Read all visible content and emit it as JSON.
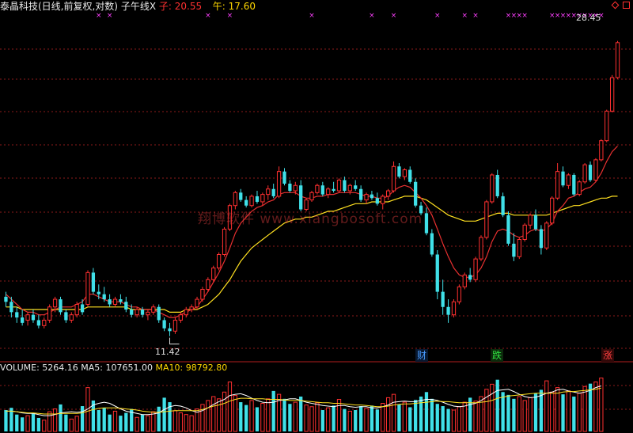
{
  "header": {
    "title": "泰晶科技(日线,前复权,对数)",
    "indicator": "子午线X",
    "zi_label": "子:",
    "zi_value": "20.55",
    "wu_label": "午:",
    "wu_value": "17.60"
  },
  "price_labels": {
    "high": "28.45",
    "low": "11.42"
  },
  "badges": {
    "cai": "财",
    "die": "跌",
    "zhang": "涨"
  },
  "volume_header": {
    "volume_label": "VOLUME:",
    "volume_value": "5264.16",
    "ma5_label": "MA5:",
    "ma5_value": "107651.00",
    "ma10_label": "MA10:",
    "ma10_value": "98792.80"
  },
  "watermark": "翔博软件 www.xiangbosoft.com",
  "colors": {
    "up": "#ff3030",
    "down": "#40e0e8",
    "line_zi": "#e83030",
    "line_wu": "#ffe020",
    "grid": "#8b1a1a",
    "marker": "#ff40ff"
  },
  "chart_data": {
    "type": "candlestick",
    "scale": "log",
    "candles": [
      {
        "o": 12.9,
        "h": 13.1,
        "l": 12.5,
        "c": 12.7
      },
      {
        "o": 12.7,
        "h": 12.9,
        "l": 12.1,
        "c": 12.3
      },
      {
        "o": 12.3,
        "h": 12.5,
        "l": 11.9,
        "c": 12.1
      },
      {
        "o": 12.1,
        "h": 12.4,
        "l": 11.8,
        "c": 11.9
      },
      {
        "o": 12.0,
        "h": 12.3,
        "l": 11.8,
        "c": 12.2
      },
      {
        "o": 12.2,
        "h": 12.4,
        "l": 11.9,
        "c": 12.0
      },
      {
        "o": 12.0,
        "h": 12.2,
        "l": 11.7,
        "c": 11.8
      },
      {
        "o": 11.8,
        "h": 12.1,
        "l": 11.7,
        "c": 12.0
      },
      {
        "o": 12.0,
        "h": 12.6,
        "l": 11.9,
        "c": 12.5
      },
      {
        "o": 12.5,
        "h": 12.9,
        "l": 12.3,
        "c": 12.8
      },
      {
        "o": 12.8,
        "h": 12.9,
        "l": 12.2,
        "c": 12.3
      },
      {
        "o": 12.3,
        "h": 12.4,
        "l": 11.9,
        "c": 12.0
      },
      {
        "o": 12.0,
        "h": 12.3,
        "l": 11.9,
        "c": 12.2
      },
      {
        "o": 12.2,
        "h": 12.7,
        "l": 12.1,
        "c": 12.6
      },
      {
        "o": 12.6,
        "h": 12.8,
        "l": 12.2,
        "c": 12.3
      },
      {
        "o": 12.6,
        "h": 14.0,
        "l": 12.5,
        "c": 13.9
      },
      {
        "o": 13.9,
        "h": 14.1,
        "l": 13.0,
        "c": 13.1
      },
      {
        "o": 13.1,
        "h": 13.4,
        "l": 12.8,
        "c": 13.0
      },
      {
        "o": 13.0,
        "h": 13.3,
        "l": 12.7,
        "c": 12.8
      },
      {
        "o": 12.8,
        "h": 13.0,
        "l": 12.5,
        "c": 12.6
      },
      {
        "o": 12.6,
        "h": 12.9,
        "l": 12.5,
        "c": 12.8
      },
      {
        "o": 12.8,
        "h": 13.0,
        "l": 12.6,
        "c": 12.7
      },
      {
        "o": 12.7,
        "h": 12.9,
        "l": 12.3,
        "c": 12.4
      },
      {
        "o": 12.4,
        "h": 12.6,
        "l": 12.1,
        "c": 12.2
      },
      {
        "o": 12.2,
        "h": 12.5,
        "l": 12.1,
        "c": 12.4
      },
      {
        "o": 12.4,
        "h": 12.5,
        "l": 12.1,
        "c": 12.2
      },
      {
        "o": 12.2,
        "h": 12.4,
        "l": 12.0,
        "c": 12.3
      },
      {
        "o": 12.3,
        "h": 12.6,
        "l": 12.2,
        "c": 12.5
      },
      {
        "o": 12.5,
        "h": 12.6,
        "l": 11.9,
        "c": 12.0
      },
      {
        "o": 12.0,
        "h": 12.1,
        "l": 11.6,
        "c": 11.7
      },
      {
        "o": 11.7,
        "h": 11.9,
        "l": 11.42,
        "c": 11.6
      },
      {
        "o": 11.6,
        "h": 12.1,
        "l": 11.5,
        "c": 12.0
      },
      {
        "o": 12.0,
        "h": 12.3,
        "l": 11.9,
        "c": 12.2
      },
      {
        "o": 12.2,
        "h": 12.5,
        "l": 12.1,
        "c": 12.4
      },
      {
        "o": 12.4,
        "h": 12.6,
        "l": 12.3,
        "c": 12.5
      },
      {
        "o": 12.5,
        "h": 12.9,
        "l": 12.4,
        "c": 12.8
      },
      {
        "o": 12.8,
        "h": 13.3,
        "l": 12.7,
        "c": 13.2
      },
      {
        "o": 13.2,
        "h": 13.7,
        "l": 13.1,
        "c": 13.6
      },
      {
        "o": 13.6,
        "h": 14.2,
        "l": 13.5,
        "c": 14.1
      },
      {
        "o": 14.1,
        "h": 14.8,
        "l": 14.0,
        "c": 14.7
      },
      {
        "o": 14.7,
        "h": 16.0,
        "l": 14.6,
        "c": 15.9
      },
      {
        "o": 15.9,
        "h": 17.2,
        "l": 15.8,
        "c": 17.1
      },
      {
        "o": 17.1,
        "h": 17.9,
        "l": 16.9,
        "c": 17.8
      },
      {
        "o": 17.8,
        "h": 18.0,
        "l": 17.3,
        "c": 17.4
      },
      {
        "o": 17.4,
        "h": 17.6,
        "l": 17.0,
        "c": 17.1
      },
      {
        "o": 17.1,
        "h": 17.7,
        "l": 17.0,
        "c": 17.6
      },
      {
        "o": 17.6,
        "h": 17.9,
        "l": 17.2,
        "c": 17.3
      },
      {
        "o": 17.3,
        "h": 17.8,
        "l": 17.1,
        "c": 17.7
      },
      {
        "o": 17.7,
        "h": 18.2,
        "l": 17.4,
        "c": 18.0
      },
      {
        "o": 18.0,
        "h": 18.3,
        "l": 17.5,
        "c": 17.6
      },
      {
        "o": 17.6,
        "h": 19.3,
        "l": 17.5,
        "c": 19.0
      },
      {
        "o": 19.0,
        "h": 19.2,
        "l": 18.2,
        "c": 18.3
      },
      {
        "o": 18.3,
        "h": 18.5,
        "l": 17.8,
        "c": 17.9
      },
      {
        "o": 17.9,
        "h": 18.4,
        "l": 17.7,
        "c": 18.2
      },
      {
        "o": 18.2,
        "h": 18.5,
        "l": 16.8,
        "c": 16.9
      },
      {
        "o": 16.9,
        "h": 17.5,
        "l": 16.8,
        "c": 17.4
      },
      {
        "o": 17.4,
        "h": 17.9,
        "l": 17.3,
        "c": 17.8
      },
      {
        "o": 17.8,
        "h": 18.3,
        "l": 17.7,
        "c": 18.2
      },
      {
        "o": 18.2,
        "h": 18.4,
        "l": 17.6,
        "c": 17.7
      },
      {
        "o": 17.7,
        "h": 18.1,
        "l": 17.5,
        "c": 18.0
      },
      {
        "o": 18.0,
        "h": 18.4,
        "l": 17.8,
        "c": 17.9
      },
      {
        "o": 17.9,
        "h": 18.6,
        "l": 17.8,
        "c": 18.5
      },
      {
        "o": 18.5,
        "h": 18.7,
        "l": 17.8,
        "c": 17.9
      },
      {
        "o": 17.9,
        "h": 18.3,
        "l": 17.7,
        "c": 18.2
      },
      {
        "o": 18.2,
        "h": 18.5,
        "l": 17.9,
        "c": 18.0
      },
      {
        "o": 18.0,
        "h": 18.2,
        "l": 17.3,
        "c": 17.4
      },
      {
        "o": 17.4,
        "h": 17.8,
        "l": 17.2,
        "c": 17.7
      },
      {
        "o": 17.7,
        "h": 17.9,
        "l": 17.4,
        "c": 17.5
      },
      {
        "o": 17.5,
        "h": 17.8,
        "l": 17.1,
        "c": 17.2
      },
      {
        "o": 17.2,
        "h": 17.7,
        "l": 16.9,
        "c": 17.6
      },
      {
        "o": 17.6,
        "h": 18.0,
        "l": 17.4,
        "c": 17.9
      },
      {
        "o": 17.9,
        "h": 19.6,
        "l": 17.8,
        "c": 19.3
      },
      {
        "o": 19.3,
        "h": 19.5,
        "l": 18.6,
        "c": 18.7
      },
      {
        "o": 18.7,
        "h": 19.2,
        "l": 18.5,
        "c": 19.1
      },
      {
        "o": 19.1,
        "h": 19.3,
        "l": 18.3,
        "c": 18.4
      },
      {
        "o": 18.4,
        "h": 18.6,
        "l": 17.0,
        "c": 17.1
      },
      {
        "o": 17.1,
        "h": 17.3,
        "l": 16.6,
        "c": 16.7
      },
      {
        "o": 16.7,
        "h": 17.0,
        "l": 15.6,
        "c": 15.7
      },
      {
        "o": 15.7,
        "h": 15.9,
        "l": 14.6,
        "c": 14.7
      },
      {
        "o": 14.7,
        "h": 14.9,
        "l": 12.8,
        "c": 13.1
      },
      {
        "o": 13.1,
        "h": 13.6,
        "l": 12.2,
        "c": 12.5
      },
      {
        "o": 12.5,
        "h": 12.8,
        "l": 11.9,
        "c": 12.2
      },
      {
        "o": 12.2,
        "h": 12.8,
        "l": 12.1,
        "c": 12.7
      },
      {
        "o": 12.7,
        "h": 13.4,
        "l": 12.6,
        "c": 13.3
      },
      {
        "o": 13.3,
        "h": 13.9,
        "l": 13.2,
        "c": 13.8
      },
      {
        "o": 13.8,
        "h": 14.1,
        "l": 13.5,
        "c": 13.6
      },
      {
        "o": 13.6,
        "h": 14.6,
        "l": 13.5,
        "c": 14.5
      },
      {
        "o": 14.5,
        "h": 15.6,
        "l": 14.4,
        "c": 15.5
      },
      {
        "o": 15.5,
        "h": 17.4,
        "l": 15.4,
        "c": 17.3
      },
      {
        "o": 17.3,
        "h": 18.9,
        "l": 17.2,
        "c": 18.8
      },
      {
        "o": 18.8,
        "h": 19.1,
        "l": 17.5,
        "c": 17.6
      },
      {
        "o": 17.6,
        "h": 17.8,
        "l": 16.5,
        "c": 16.6
      },
      {
        "o": 16.6,
        "h": 16.8,
        "l": 15.1,
        "c": 15.2
      },
      {
        "o": 15.2,
        "h": 15.7,
        "l": 14.4,
        "c": 14.6
      },
      {
        "o": 14.6,
        "h": 15.5,
        "l": 14.5,
        "c": 15.4
      },
      {
        "o": 15.4,
        "h": 16.2,
        "l": 15.3,
        "c": 16.1
      },
      {
        "o": 16.1,
        "h": 16.7,
        "l": 15.9,
        "c": 16.6
      },
      {
        "o": 16.6,
        "h": 16.9,
        "l": 15.8,
        "c": 15.9
      },
      {
        "o": 15.9,
        "h": 16.1,
        "l": 14.7,
        "c": 15.0
      },
      {
        "o": 15.0,
        "h": 16.3,
        "l": 14.9,
        "c": 16.2
      },
      {
        "o": 16.2,
        "h": 17.6,
        "l": 16.1,
        "c": 17.5
      },
      {
        "o": 17.5,
        "h": 19.5,
        "l": 17.4,
        "c": 19.0
      },
      {
        "o": 19.0,
        "h": 19.3,
        "l": 18.1,
        "c": 18.2
      },
      {
        "o": 18.2,
        "h": 18.9,
        "l": 18.0,
        "c": 18.8
      },
      {
        "o": 18.8,
        "h": 18.9,
        "l": 17.6,
        "c": 17.7
      },
      {
        "o": 17.7,
        "h": 18.5,
        "l": 17.6,
        "c": 18.4
      },
      {
        "o": 18.4,
        "h": 19.5,
        "l": 18.3,
        "c": 19.4
      },
      {
        "o": 19.4,
        "h": 19.6,
        "l": 18.4,
        "c": 18.5
      },
      {
        "o": 18.5,
        "h": 19.8,
        "l": 18.4,
        "c": 19.7
      },
      {
        "o": 19.7,
        "h": 21.0,
        "l": 19.6,
        "c": 20.9
      },
      {
        "o": 20.9,
        "h": 23.0,
        "l": 20.8,
        "c": 22.9
      },
      {
        "o": 22.9,
        "h": 25.6,
        "l": 22.8,
        "c": 25.4
      },
      {
        "o": 25.4,
        "h": 28.45,
        "l": 25.3,
        "c": 28.3
      }
    ],
    "volumes": [
      38,
      42,
      30,
      25,
      28,
      33,
      24,
      20,
      35,
      40,
      48,
      30,
      22,
      27,
      45,
      78,
      55,
      38,
      42,
      30,
      36,
      28,
      33,
      40,
      25,
      30,
      28,
      35,
      44,
      60,
      52,
      37,
      33,
      30,
      28,
      40,
      48,
      55,
      62,
      58,
      70,
      88,
      64,
      52,
      47,
      55,
      43,
      50,
      58,
      72,
      66,
      58,
      49,
      52,
      62,
      47,
      44,
      51,
      38,
      42,
      46,
      57,
      40,
      36,
      38,
      45,
      41,
      46,
      39,
      50,
      60,
      66,
      48,
      52,
      43,
      56,
      62,
      70,
      58,
      49,
      45,
      40,
      38,
      44,
      52,
      60,
      54,
      62,
      75,
      84,
      92,
      70,
      65,
      58,
      62,
      55,
      60,
      68,
      74,
      90,
      70,
      78,
      66,
      72,
      62,
      68,
      80,
      85,
      88,
      95
    ],
    "line_zi": [
      13.0,
      12.8,
      12.6,
      12.4,
      12.3,
      12.3,
      12.2,
      12.2,
      12.3,
      12.4,
      12.5,
      12.5,
      12.5,
      12.6,
      12.7,
      13.0,
      13.0,
      12.9,
      12.8,
      12.7,
      12.7,
      12.7,
      12.6,
      12.5,
      12.5,
      12.4,
      12.4,
      12.4,
      12.3,
      12.2,
      12.1,
      12.1,
      12.2,
      12.3,
      12.4,
      12.5,
      12.8,
      13.1,
      13.5,
      13.9,
      14.4,
      15.0,
      15.7,
      16.2,
      16.5,
      16.8,
      17.0,
      17.1,
      17.3,
      17.4,
      17.7,
      17.8,
      17.8,
      17.8,
      17.6,
      17.5,
      17.5,
      17.6,
      17.6,
      17.7,
      17.7,
      17.8,
      17.8,
      17.8,
      17.8,
      17.7,
      17.6,
      17.6,
      17.5,
      17.5,
      17.6,
      17.9,
      18.1,
      18.2,
      18.1,
      17.8,
      17.5,
      17.1,
      16.6,
      15.9,
      15.2,
      14.6,
      14.1,
      13.8,
      13.7,
      13.7,
      13.8,
      14.1,
      14.6,
      15.3,
      15.8,
      15.9,
      15.8,
      15.6,
      15.5,
      15.6,
      15.8,
      15.9,
      15.8,
      15.9,
      16.2,
      16.8,
      17.1,
      17.5,
      17.6,
      17.8,
      18.0,
      18.1,
      18.4,
      18.9,
      19.6,
      20.2,
      20.55
    ],
    "line_wu": [
      12.5,
      12.5,
      12.5,
      12.4,
      12.4,
      12.4,
      12.4,
      12.4,
      12.4,
      12.4,
      12.4,
      12.4,
      12.4,
      12.4,
      12.4,
      12.5,
      12.5,
      12.5,
      12.5,
      12.5,
      12.5,
      12.5,
      12.5,
      12.4,
      12.4,
      12.4,
      12.4,
      12.4,
      12.4,
      12.4,
      12.3,
      12.3,
      12.3,
      12.4,
      12.4,
      12.4,
      12.5,
      12.6,
      12.8,
      13.0,
      13.3,
      13.6,
      14.0,
      14.4,
      14.7,
      15.0,
      15.2,
      15.4,
      15.6,
      15.8,
      16.0,
      16.2,
      16.3,
      16.4,
      16.4,
      16.5,
      16.5,
      16.6,
      16.7,
      16.8,
      16.8,
      16.9,
      17.0,
      17.1,
      17.2,
      17.2,
      17.2,
      17.3,
      17.3,
      17.3,
      17.3,
      17.4,
      17.5,
      17.6,
      17.6,
      17.6,
      17.5,
      17.4,
      17.2,
      17.0,
      16.8,
      16.6,
      16.5,
      16.4,
      16.3,
      16.3,
      16.3,
      16.4,
      16.5,
      16.6,
      16.7,
      16.7,
      16.7,
      16.6,
      16.6,
      16.6,
      16.6,
      16.6,
      16.6,
      16.6,
      16.7,
      16.8,
      16.9,
      17.0,
      17.1,
      17.1,
      17.2,
      17.3,
      17.4,
      17.5,
      17.5,
      17.6,
      17.6
    ],
    "vol_ma5": [
      36,
      36,
      35,
      33,
      32,
      32,
      30,
      28,
      28,
      30,
      33,
      34,
      35,
      34,
      35,
      40,
      47,
      50,
      52,
      50,
      45,
      40,
      36,
      34,
      32,
      30,
      30,
      31,
      33,
      39,
      44,
      46,
      45,
      42,
      37,
      34,
      37,
      42,
      48,
      53,
      57,
      64,
      66,
      67,
      64,
      59,
      55,
      52,
      51,
      52,
      55,
      56,
      58,
      58,
      55,
      52,
      50,
      48,
      46,
      45,
      44,
      46,
      46,
      44,
      43,
      44,
      44,
      42,
      42,
      44,
      47,
      52,
      53,
      54,
      53,
      53,
      55,
      57,
      57,
      55,
      52,
      48,
      45,
      44,
      45,
      48,
      50,
      55,
      61,
      67,
      73,
      74,
      75,
      71,
      66,
      62,
      60,
      61,
      64,
      68,
      70,
      74,
      75,
      72,
      70,
      68,
      70,
      73,
      78,
      81
    ],
    "vol_ma10": [
      36,
      36,
      35,
      34,
      33,
      33,
      32,
      31,
      31,
      31,
      32,
      32,
      32,
      32,
      33,
      36,
      39,
      41,
      42,
      42,
      42,
      41,
      40,
      39,
      38,
      36,
      35,
      34,
      34,
      35,
      36,
      37,
      37,
      37,
      37,
      37,
      39,
      42,
      45,
      47,
      50,
      54,
      57,
      59,
      59,
      58,
      58,
      58,
      57,
      57,
      57,
      56,
      55,
      55,
      55,
      54,
      53,
      52,
      51,
      51,
      50,
      50,
      49,
      48,
      47,
      47,
      46,
      45,
      44,
      44,
      45,
      47,
      48,
      49,
      49,
      50,
      51,
      52,
      53,
      54,
      53,
      53,
      52,
      51,
      51,
      51,
      51,
      52,
      53,
      55,
      59,
      61,
      63,
      64,
      65,
      66,
      67,
      68,
      68,
      68,
      68,
      68,
      70,
      71,
      71,
      72,
      73,
      74,
      75,
      77
    ],
    "price_range": [
      11.0,
      30.0
    ]
  }
}
